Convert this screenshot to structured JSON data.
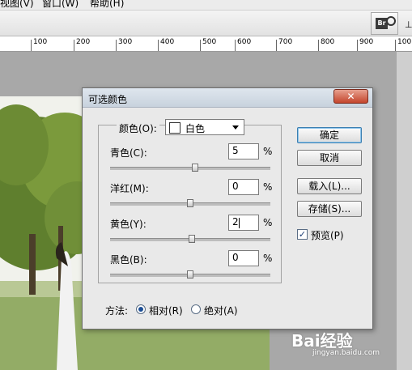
{
  "menu": {
    "items": [
      "视图(V)",
      "窗口(W)",
      "帮助(H)"
    ]
  },
  "toolbar": {
    "bridge_icon": "bridge-launcher-icon",
    "right_glyph": "⊥"
  },
  "ruler": {
    "labels": [
      "100",
      "200",
      "300",
      "400",
      "500",
      "600",
      "700",
      "800",
      "900",
      "100"
    ]
  },
  "dialog": {
    "title": "可选颜色",
    "close_label": "✕",
    "color_label": "颜色(O):",
    "color_value": "白色",
    "sliders": [
      {
        "label": "青色(C):",
        "value": "5",
        "unit": "%",
        "position": 0.53
      },
      {
        "label": "洋红(M):",
        "value": "0",
        "unit": "%",
        "position": 0.5
      },
      {
        "label": "黄色(Y):",
        "value": "2",
        "unit": "%",
        "position": 0.51
      },
      {
        "label": "黑色(B):",
        "value": "0",
        "unit": "%",
        "position": 0.5
      }
    ],
    "buttons": {
      "ok": "确定",
      "cancel": "取消",
      "load": "载入(L)...",
      "save": "存储(S)..."
    },
    "preview": {
      "label": "预览(P)",
      "checked": true
    },
    "method": {
      "label": "方法:",
      "options": [
        {
          "label": "相对(R)",
          "selected": true
        },
        {
          "label": "绝对(A)",
          "selected": false
        }
      ]
    }
  },
  "watermark": {
    "brand": "Bai经验",
    "url": "jingyan.baidu.com"
  }
}
